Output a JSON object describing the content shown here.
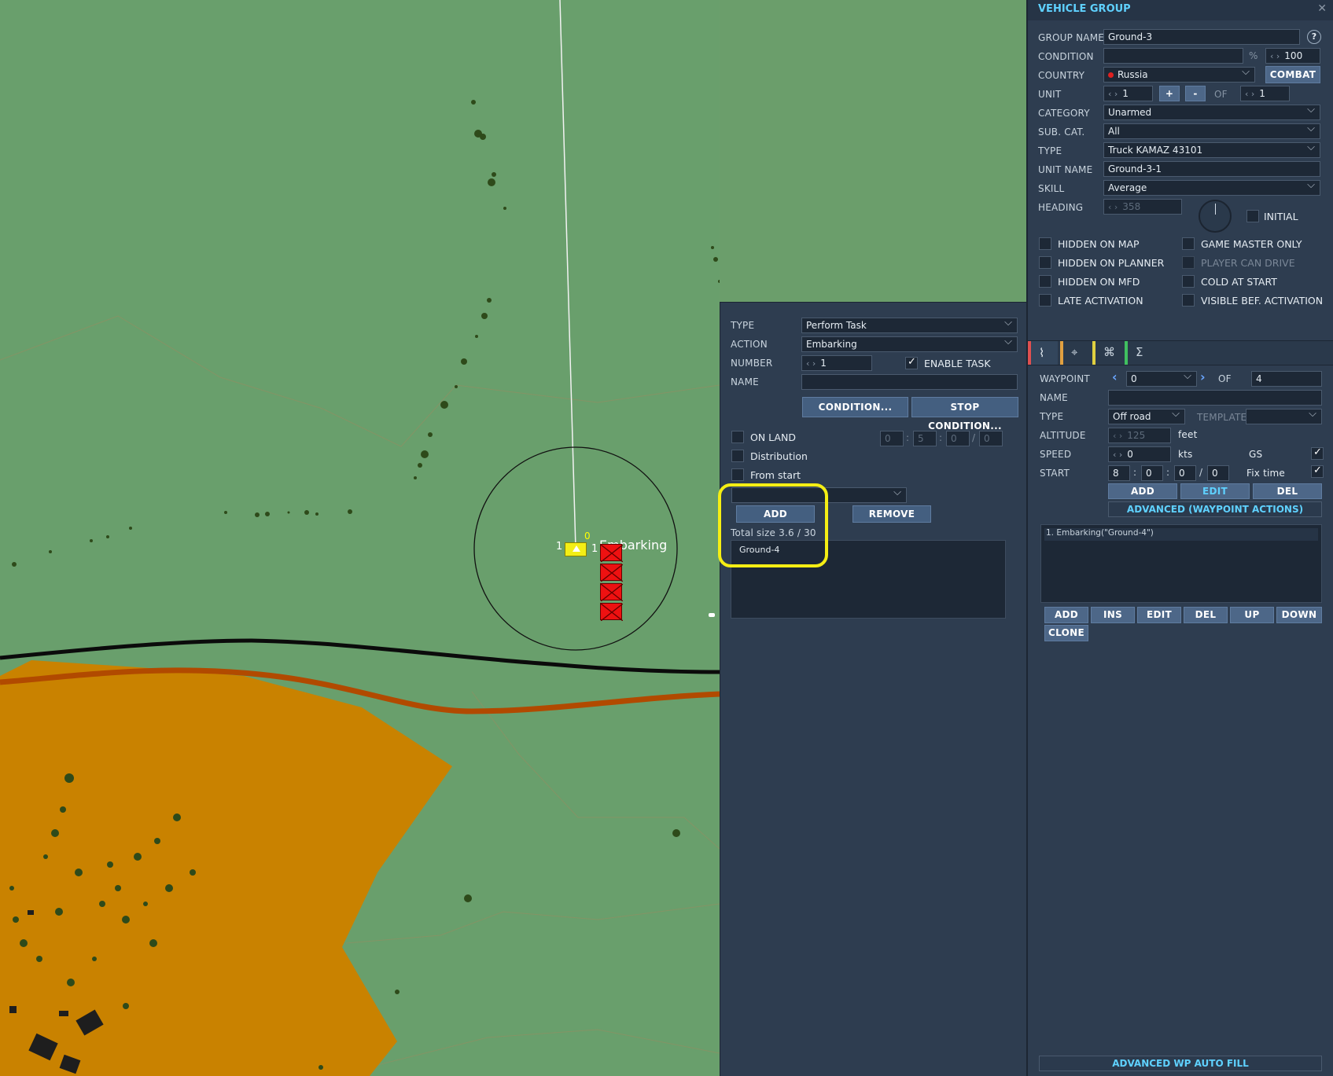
{
  "map": {
    "label_embarking": "Embarking",
    "label_zero": "0",
    "label_one_left": "1",
    "label_one_right": "1"
  },
  "task_panel": {
    "type_label": "TYPE",
    "type_value": "Perform Task",
    "action_label": "ACTION",
    "action_value": "Embarking",
    "number_label": "NUMBER",
    "number_value": "1",
    "enable_task_label": "ENABLE TASK",
    "enable_task_checked": true,
    "name_label": "NAME",
    "name_value": "",
    "condition_button": "CONDITION...",
    "stop_condition_button": "STOP CONDITION...",
    "on_land_label": "ON LAND",
    "distribution_label": "Distribution",
    "from_start_label": "From start",
    "time_values": [
      "0",
      "5",
      "0",
      "0"
    ],
    "group_select_value": "",
    "add_button": "ADD",
    "remove_button": "REMOVE",
    "total_size": "Total size 3.6 / 30",
    "group_list": [
      "Ground-4"
    ]
  },
  "vehicle_group": {
    "title": "VEHICLE GROUP",
    "close_icon": "close-icon",
    "group_name_label": "GROUP NAME",
    "group_name_value": "Ground-3",
    "help": "?",
    "condition_label": "CONDITION",
    "condition_value": "",
    "percent": "%",
    "condition_pct": "100",
    "country_label": "COUNTRY",
    "country_value": "Russia",
    "country_color": "#e02020",
    "combat_button": "COMBAT",
    "unit_label": "UNIT",
    "unit_value": "1",
    "plus": "+",
    "minus": "-",
    "of_label": "OF",
    "unit_of_value": "1",
    "category_label": "CATEGORY",
    "category_value": "Unarmed",
    "subcat_label": "SUB. CAT.",
    "subcat_value": "All",
    "type_label": "TYPE",
    "type_value": "Truck KAMAZ 43101",
    "unit_name_label": "UNIT NAME",
    "unit_name_value": "Ground-3-1",
    "skill_label": "SKILL",
    "skill_value": "Average",
    "heading_label": "HEADING",
    "heading_value": "358",
    "initial_label": "INITIAL",
    "checkboxes_left": [
      "HIDDEN ON MAP",
      "HIDDEN ON PLANNER",
      "HIDDEN ON MFD",
      "LATE ACTIVATION"
    ],
    "checkboxes_right": [
      "GAME MASTER ONLY",
      "PLAYER CAN DRIVE",
      "COLD AT START",
      "VISIBLE BEF. ACTIVATION"
    ]
  },
  "tabs": {
    "icons": [
      "route-icon",
      "target-icon",
      "triggers-icon",
      "summary-icon"
    ],
    "colors": [
      "#e05050",
      "#e0a040",
      "#e0d040",
      "#40c060"
    ]
  },
  "waypoint": {
    "waypoint_label": "WAYPOINT",
    "waypoint_value": "0",
    "of_label": "OF",
    "of_value": "4",
    "name_label": "NAME",
    "name_value": "",
    "type_label": "TYPE",
    "type_value": "Off road",
    "template_label": "TEMPLATE",
    "template_value": "",
    "altitude_label": "ALTITUDE",
    "altitude_value": "125",
    "altitude_unit": "feet",
    "speed_label": "SPEED",
    "speed_value": "0",
    "speed_unit": "kts",
    "gs_label": "GS",
    "start_label": "START",
    "start_values": [
      "8",
      "0",
      "0",
      "0"
    ],
    "fix_time_label": "Fix time",
    "add": "ADD",
    "edit": "EDIT",
    "del": "DEL",
    "advanced_actions": "ADVANCED (WAYPOINT ACTIONS)",
    "actions_list": [
      "1. Embarking(\"Ground-4\")"
    ],
    "list_buttons": [
      "ADD",
      "INS",
      "EDIT",
      "DEL",
      "UP",
      "DOWN",
      "CLONE"
    ],
    "auto_fill": "ADVANCED WP AUTO FILL"
  }
}
